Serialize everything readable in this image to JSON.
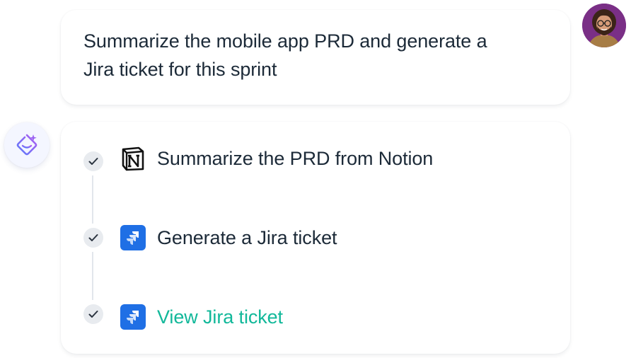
{
  "user_message": {
    "line1": "Summarize the mobile app PRD and generate a",
    "line2": "Jira ticket for this sprint"
  },
  "steps": [
    {
      "label": "Summarize the PRD from Notion",
      "app": "notion-icon",
      "status": "done"
    },
    {
      "label": "Generate a Jira ticket",
      "app": "jira-icon",
      "status": "done"
    },
    {
      "label": "View Jira ticket",
      "app": "jira-icon",
      "status": "done",
      "is_link": true
    }
  ],
  "colors": {
    "link": "#12b89a",
    "jira_blue": "#1f6fe5",
    "assistant_icon_gradient_start": "#5b7cfa",
    "assistant_icon_gradient_end": "#b15cf0",
    "avatar_bg": "#7a2f86"
  }
}
